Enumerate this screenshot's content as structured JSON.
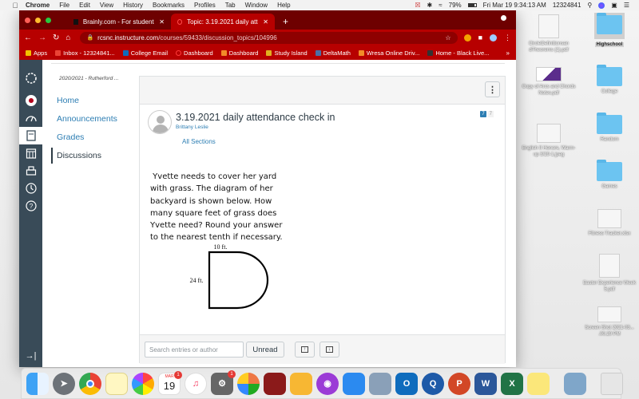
{
  "menubar": {
    "app": "Chrome",
    "items": [
      "File",
      "Edit",
      "View",
      "History",
      "Bookmarks",
      "Profiles",
      "Tab",
      "Window",
      "Help"
    ],
    "battery": "79%",
    "datetime": "Fri Mar 19  9:34:13 AM",
    "user": "12324841"
  },
  "browser": {
    "tabs": [
      {
        "title": "Brainly.com - For students. By",
        "active": false
      },
      {
        "title": "Topic: 3.19.2021 daily attendar",
        "active": true
      }
    ],
    "new_tab": "+",
    "url_host": "rcsnc.instructure.com",
    "url_path": "/courses/59433/discussion_topics/104996",
    "bookmarks": [
      {
        "label": "Apps",
        "color": "#f2c200"
      },
      {
        "label": "Inbox - 12324841...",
        "color": "#ea4335"
      },
      {
        "label": "College Email",
        "color": "#0f6cbd"
      },
      {
        "label": "Dashboard",
        "color": "#ff3b3b"
      },
      {
        "label": "Dashboard",
        "color": "#f28c28"
      },
      {
        "label": "Study Island",
        "color": "#e0b020"
      },
      {
        "label": "DeltaMath",
        "color": "#4a6fa5"
      },
      {
        "label": "Wresa Online Driv...",
        "color": "#f28c28"
      },
      {
        "label": "Home - Black Live...",
        "color": "#333333"
      }
    ],
    "bookmarks_more": "»"
  },
  "canvas": {
    "course_crumb": "2020/2021 - Rutherford ...",
    "course_nav": [
      {
        "label": "Home",
        "active": false
      },
      {
        "label": "Announcements",
        "active": false
      },
      {
        "label": "Grades",
        "active": false
      },
      {
        "label": "Discussions",
        "active": true
      }
    ],
    "global_nav_icons": [
      "canvas-logo-icon",
      "account-avatar-icon",
      "dashboard-icon",
      "courses-icon",
      "calendar-icon",
      "inbox-icon",
      "history-icon",
      "help-icon"
    ],
    "collapse_label": "→|",
    "kebab_label": "⋮",
    "entry": {
      "title": "3.19.2021 daily attendance check in",
      "author": "Brittany Leslie",
      "sections": "All Sections",
      "unread_count": "7",
      "total_count": "7"
    },
    "question_lines": [
      " Yvette needs to cover her yard",
      "with grass.  The diagram of her",
      "backyard is shown below.  How",
      "many square feet of grass does",
      "Yvette need? Round your answer",
      "to the nearest tenth if necessary."
    ],
    "diagram": {
      "width_label": "10 ft.",
      "height_label": "24 ft."
    },
    "footer": {
      "search_placeholder": "Search entries or author",
      "search_value": "",
      "unread_button": "Unread",
      "expand_icon": "↑",
      "collapse_icon": "↓"
    }
  },
  "desktop_icons": [
    {
      "label": "CircleDefinitionsan dTheorems (1).pdf",
      "type": "doc"
    },
    {
      "label": "Highschool",
      "type": "folder",
      "selected": true
    },
    {
      "label": "Copy of Arcs and Chords Notes.pdf",
      "type": "doc"
    },
    {
      "label": "College",
      "type": "folder"
    },
    {
      "label": "English II Honors, Warm-up 3/19-1.jpeg",
      "type": "doc"
    },
    {
      "label": "Random",
      "type": "folder"
    },
    {
      "label": "Games",
      "type": "folder"
    },
    {
      "label": "Fitness Tracker.xlsx",
      "type": "doc"
    },
    {
      "label": "Easter Experience Week 5.pdf",
      "type": "doc"
    },
    {
      "label": "Screen Shot 2021-03... .00.20 PM",
      "type": "doc"
    }
  ],
  "dock": {
    "calendar_month": "MAR",
    "calendar_day": "19",
    "calendar_badge": "1",
    "settings_badge": "1",
    "apps": [
      "Finder",
      "Launchpad",
      "Chrome",
      "Notes",
      "Photos",
      "Calendar",
      "Music",
      "System Preferences",
      "Microsoft Remote",
      "Photo Booth",
      "Pages",
      "Podcasts",
      "Keynote",
      "Preview",
      "Outlook",
      "QuickTime",
      "PowerPoint",
      "Word",
      "Excel",
      "Stickies",
      "Image Capture",
      "Trash"
    ]
  }
}
